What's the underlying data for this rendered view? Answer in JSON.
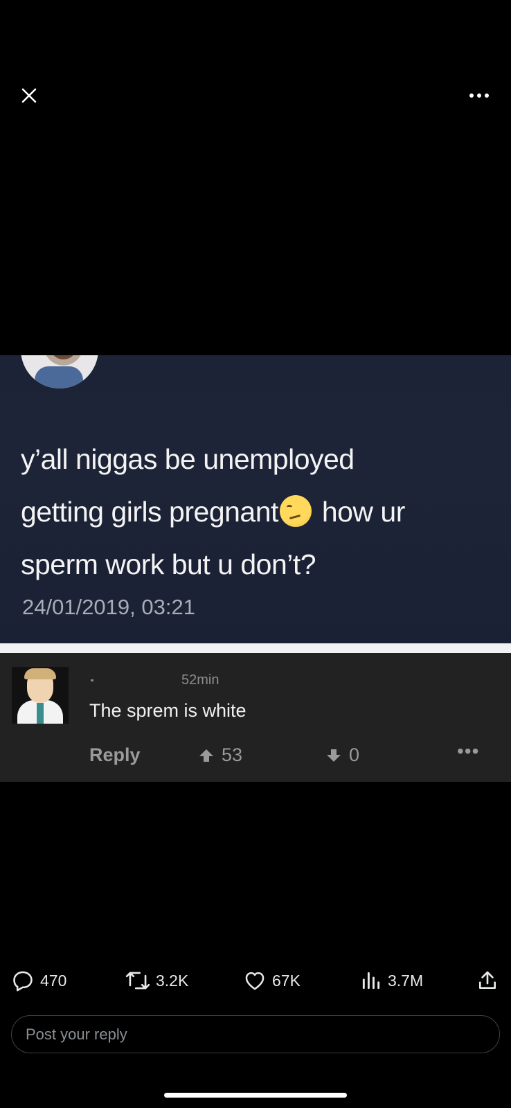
{
  "topbar": {
    "close_icon": "close-icon",
    "more_icon": "more-options-icon"
  },
  "media": {
    "tweet": {
      "text_line1": "y’all niggas be unemployed",
      "text_line2_a": "getting girls pregnant",
      "text_line2_b": " how ur",
      "text_line3": "sperm work but u don’t?",
      "emoji": "thinking-face-emoji",
      "date": "24/01/2019, 03:21"
    },
    "comment": {
      "author": "-",
      "time": "52min",
      "text": "The sprem is white",
      "reply_label": "Reply",
      "upvotes": "53",
      "downvotes": "0",
      "more_label": "•••"
    }
  },
  "actions": {
    "replies": "470",
    "reposts": "3.2K",
    "likes": "67K",
    "views": "3.7M"
  },
  "reply_box": {
    "placeholder": "Post your reply"
  }
}
